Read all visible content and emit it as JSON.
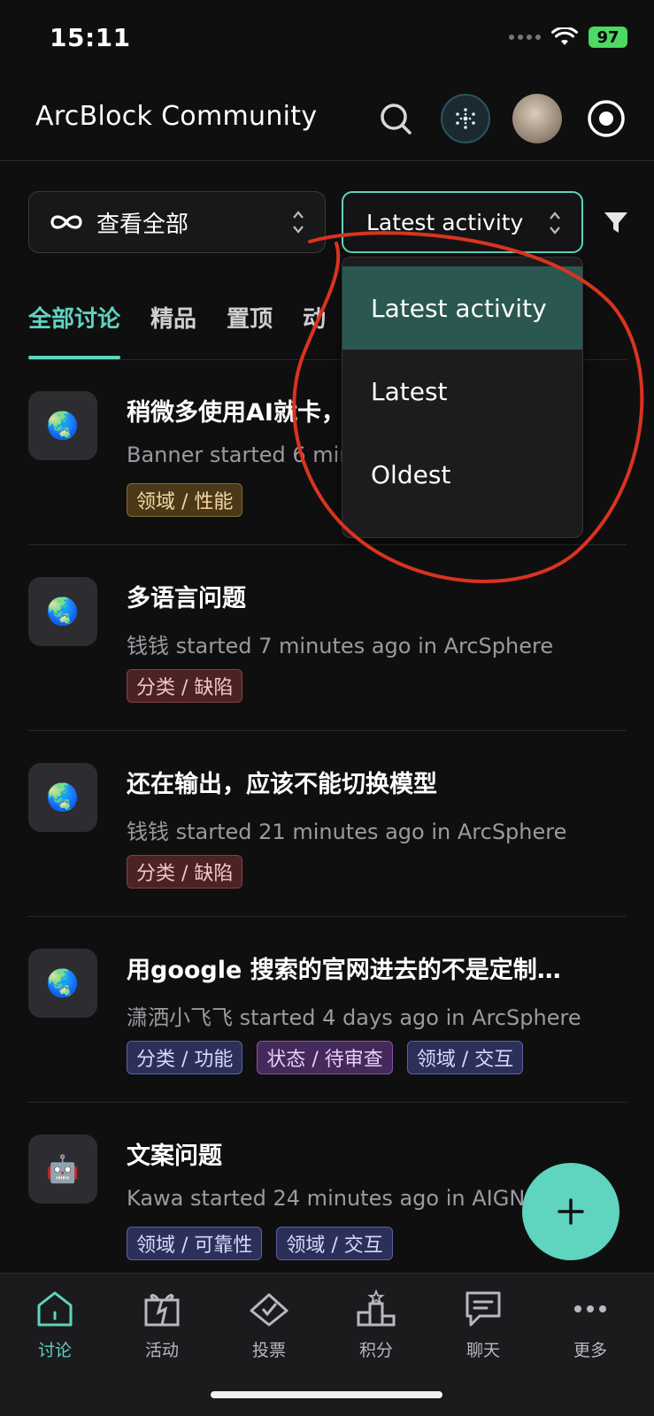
{
  "status_bar": {
    "time": "15:11",
    "battery": "97"
  },
  "header": {
    "title": "ArcBlock Community"
  },
  "filters": {
    "scope_label": "查看全部",
    "sort_label": "Latest activity"
  },
  "sort_menu": {
    "items": [
      {
        "label": "Latest activity",
        "selected": true
      },
      {
        "label": "Latest",
        "selected": false
      },
      {
        "label": "Oldest",
        "selected": false
      }
    ]
  },
  "tabs": [
    {
      "label": "全部讨论",
      "active": true
    },
    {
      "label": "精品",
      "active": false
    },
    {
      "label": "置顶",
      "active": false
    },
    {
      "label": "动",
      "active": false
    }
  ],
  "posts": [
    {
      "icon": "globe-icon",
      "title": "稍微多使用AI就卡，",
      "meta": "Banner started 6 min",
      "tags": [
        {
          "label": "领域 / 性能",
          "color": "orange"
        }
      ]
    },
    {
      "icon": "globe-icon",
      "title": "多语言问题",
      "meta": "钱钱 started 7 minutes ago in ArcSphere",
      "tags": [
        {
          "label": "分类 / 缺陷",
          "color": "red"
        }
      ]
    },
    {
      "icon": "globe-icon",
      "title": "还在输出，应该不能切换模型",
      "meta": "钱钱 started 21 minutes ago in ArcSphere",
      "tags": [
        {
          "label": "分类 / 缺陷",
          "color": "red"
        }
      ]
    },
    {
      "icon": "globe-icon",
      "title": "用google 搜索的官网进去的不是定制…",
      "meta": "潇洒小飞飞 started 4 days ago in ArcSphere",
      "tags": [
        {
          "label": "分类 / 功能",
          "color": "blue"
        },
        {
          "label": "状态 / 待审查",
          "color": "purple"
        },
        {
          "label": "领域 / 交互",
          "color": "blue"
        }
      ]
    },
    {
      "icon": "robot-icon",
      "title": "文案问题",
      "meta": "Kawa started 24 minutes ago in AIGNE",
      "tags": [
        {
          "label": "领域 / 可靠性",
          "color": "blue"
        },
        {
          "label": "领域 / 交互",
          "color": "blue"
        }
      ]
    }
  ],
  "bottom_nav": [
    {
      "label": "讨论",
      "icon": "home-icon",
      "active": true
    },
    {
      "label": "活动",
      "icon": "gift-icon",
      "active": false
    },
    {
      "label": "投票",
      "icon": "vote-icon",
      "active": false
    },
    {
      "label": "积分",
      "icon": "podium-icon",
      "active": false
    },
    {
      "label": "聊天",
      "icon": "chat-icon",
      "active": false
    },
    {
      "label": "更多",
      "icon": "more-icon",
      "active": false
    }
  ],
  "colors": {
    "accent": "#5fd4bf",
    "background": "#0f0f10",
    "annotation": "#d9341f"
  }
}
